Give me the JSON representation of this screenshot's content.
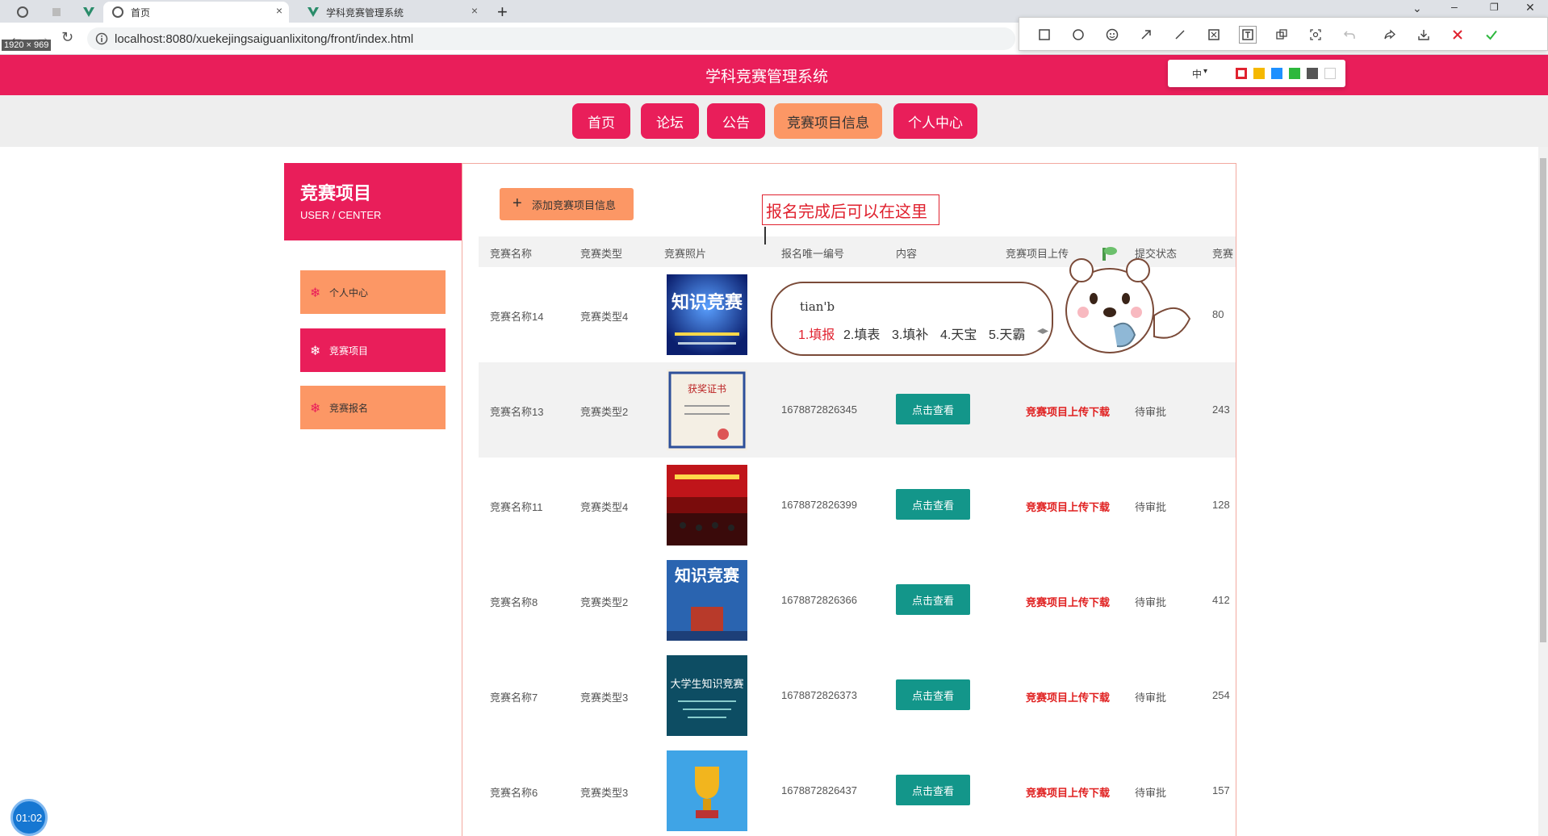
{
  "browser": {
    "tabs": [
      {
        "label": ""
      },
      {
        "label": ""
      },
      {
        "label": "首页"
      },
      {
        "label": "学科竞赛管理系统"
      }
    ],
    "url": "localhost:8080/xuekejingsaiguanlixitong/front/index.html",
    "capture_size": "1920 × 969"
  },
  "snip_tool": {
    "size_label": "中",
    "colors": [
      "#e0222f",
      "#f5b800",
      "#1e90ff",
      "#2db83d",
      "#555555",
      "#ffffff"
    ]
  },
  "site": {
    "title": "学科竞赛管理系统",
    "nav": [
      "首页",
      "论坛",
      "公告",
      "竞赛项目信息",
      "个人中心"
    ]
  },
  "sidebar": {
    "title": "竞赛项目",
    "subtitle": "USER / CENTER",
    "items": [
      "个人中心",
      "竞赛项目",
      "竞赛报名"
    ]
  },
  "main": {
    "add_button": "添加竞赛项目信息",
    "columns": [
      "竞赛名称",
      "竞赛类型",
      "竞赛照片",
      "报名唯一编号",
      "内容",
      "竞赛项目上传",
      "提交状态",
      "竞赛"
    ],
    "rows": [
      {
        "name": "竞赛名称14",
        "type": "竞赛类型4",
        "number": "",
        "view": "",
        "upload": "",
        "status": "",
        "extra": "80"
      },
      {
        "name": "竞赛名称13",
        "type": "竞赛类型2",
        "number": "1678872826345",
        "view": "点击查看",
        "upload": "竞赛项目上传下载",
        "status": "待审批",
        "extra": "243"
      },
      {
        "name": "竞赛名称11",
        "type": "竞赛类型4",
        "number": "1678872826399",
        "view": "点击查看",
        "upload": "竞赛项目上传下载",
        "status": "待审批",
        "extra": "128"
      },
      {
        "name": "竞赛名称8",
        "type": "竞赛类型2",
        "number": "1678872826366",
        "view": "点击查看",
        "upload": "竞赛项目上传下载",
        "status": "待审批",
        "extra": "412"
      },
      {
        "name": "竞赛名称7",
        "type": "竞赛类型3",
        "number": "1678872826373",
        "view": "点击查看",
        "upload": "竞赛项目上传下载",
        "status": "待审批",
        "extra": "254"
      },
      {
        "name": "竞赛名称6",
        "type": "竞赛类型3",
        "number": "1678872826437",
        "view": "点击查看",
        "upload": "竞赛项目上传下载",
        "status": "待审批",
        "extra": "157"
      }
    ],
    "thumb_texts": {
      "t1": "知识竞赛",
      "t2": "获奖证书",
      "t4": "知识竞赛",
      "t5": "大学生知识竞赛"
    }
  },
  "annotation": "报名完成后可以在这里",
  "ime": {
    "input": "tian'b",
    "candidates": [
      "1.填报",
      "2.填表",
      "3.填补",
      "4.天宝",
      "5.天霸"
    ]
  },
  "recorder": {
    "time": "01:02"
  }
}
